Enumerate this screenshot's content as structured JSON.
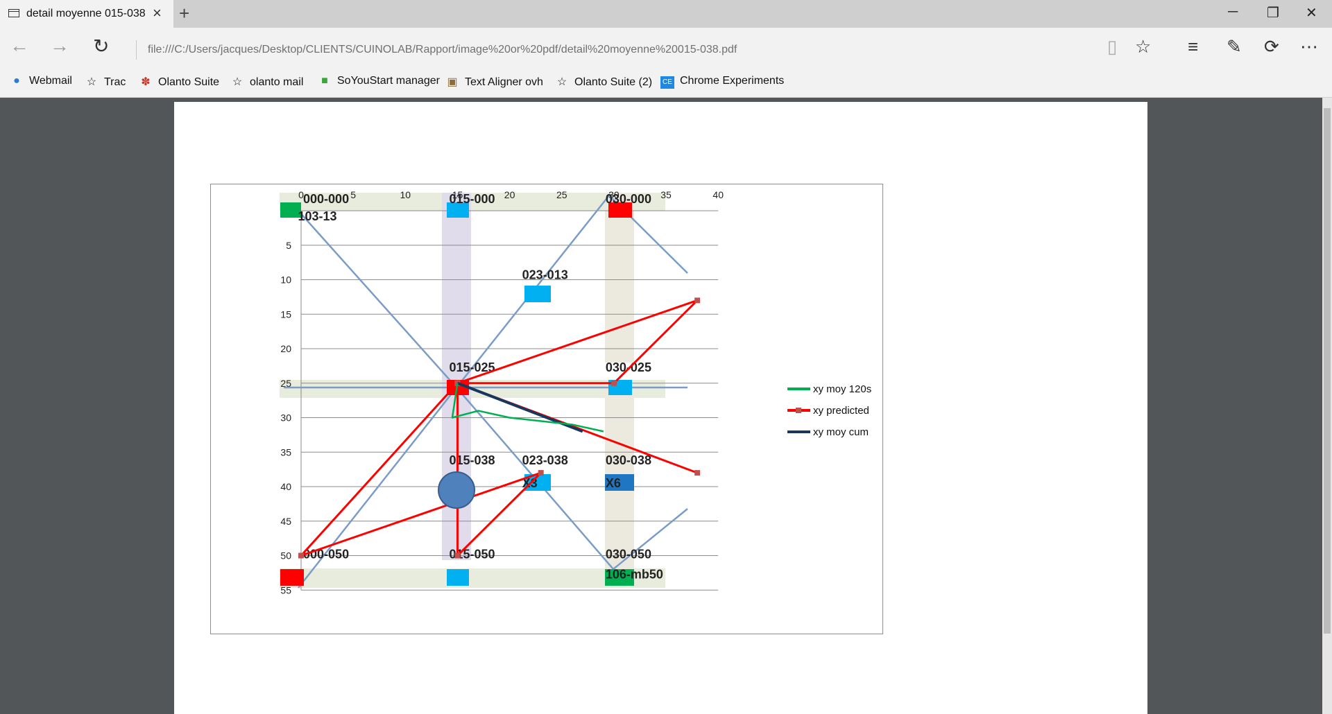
{
  "browser": {
    "tab_title": "detail moyenne 015-038",
    "new_tab_symbol": "+",
    "url": "file:///C:/Users/jacques/Desktop/CLIENTS/CUINOLAB/Rapport/image%20or%20pdf/detail%20moyenne%20015-038.pdf",
    "favorites": [
      {
        "icon": "globe-icon",
        "label": "Webmail"
      },
      {
        "icon": "star-icon",
        "label": "Trac"
      },
      {
        "icon": "paw-icon",
        "label": "Olanto Suite"
      },
      {
        "icon": "star-icon",
        "label": "olanto mail"
      },
      {
        "icon": "cube-icon",
        "label": "SoYouStart manager"
      },
      {
        "icon": "image-icon",
        "label": "Text Aligner ovh"
      },
      {
        "icon": "star-icon",
        "label": "Olanto Suite (2)"
      },
      {
        "icon": "ce-icon",
        "label": "Chrome Experiments"
      }
    ]
  },
  "chart_data": {
    "type": "scatter",
    "x_ticks": [
      "0",
      "5",
      "10",
      "15",
      "20",
      "25",
      "30",
      "35",
      "40"
    ],
    "y_ticks": [
      "0",
      "5",
      "10",
      "15",
      "20",
      "25",
      "30",
      "35",
      "40",
      "45",
      "50",
      "55"
    ],
    "xlim": [
      0,
      40
    ],
    "ylim": [
      0,
      55
    ],
    "y_inverted": true,
    "grid": "horizontal",
    "legend_position": "right",
    "legend": [
      {
        "label": "xy moy 120s",
        "color": "#00b050"
      },
      {
        "label": "xy predicted",
        "color": "#ff0000"
      },
      {
        "label": "xy moy cum",
        "color": "#17375e"
      }
    ],
    "map_labels": [
      {
        "text": "000-000",
        "x": 1,
        "y": -1.7
      },
      {
        "text": "103-13",
        "x": 0.5,
        "y": 0.8
      },
      {
        "text": "015-000",
        "x": 15,
        "y": -1.7
      },
      {
        "text": "030-000",
        "x": 30,
        "y": -1.7
      },
      {
        "text": "023-013",
        "x": 22,
        "y": 9.3
      },
      {
        "text": "015-025",
        "x": 15,
        "y": 22.7
      },
      {
        "text": "030-025",
        "x": 30,
        "y": 22.7
      },
      {
        "text": "015-038",
        "x": 15,
        "y": 36.2
      },
      {
        "text": "023-038",
        "x": 22,
        "y": 36.2
      },
      {
        "text": "030-038",
        "x": 30,
        "y": 36.2
      },
      {
        "text": "X3",
        "x": 22,
        "y": 39.5
      },
      {
        "text": "X6",
        "x": 30,
        "y": 39.5
      },
      {
        "text": "000-050",
        "x": 1,
        "y": 49.8
      },
      {
        "text": "015-050",
        "x": 15,
        "y": 49.8
      },
      {
        "text": "030-050",
        "x": 30,
        "y": 49.8
      },
      {
        "text": "106-mb50",
        "x": 30,
        "y": 52.7
      }
    ],
    "series": [
      {
        "name": "xy predicted",
        "points": [
          [
            15,
            25
          ],
          [
            30,
            25
          ],
          [
            38,
            13
          ],
          [
            15,
            25
          ],
          [
            38,
            38
          ],
          [
            15,
            25
          ],
          [
            0,
            50
          ],
          [
            23,
            38
          ],
          [
            15,
            50
          ],
          [
            15,
            25
          ]
        ]
      },
      {
        "name": "xy moy cum",
        "points": [
          [
            15,
            25
          ],
          [
            27,
            32
          ]
        ]
      },
      {
        "name": "xy moy 120s",
        "points": [
          [
            15,
            25
          ],
          [
            14.5,
            30
          ],
          [
            17,
            29
          ],
          [
            20,
            30
          ],
          [
            26,
            31
          ],
          [
            29,
            32
          ]
        ]
      }
    ]
  }
}
